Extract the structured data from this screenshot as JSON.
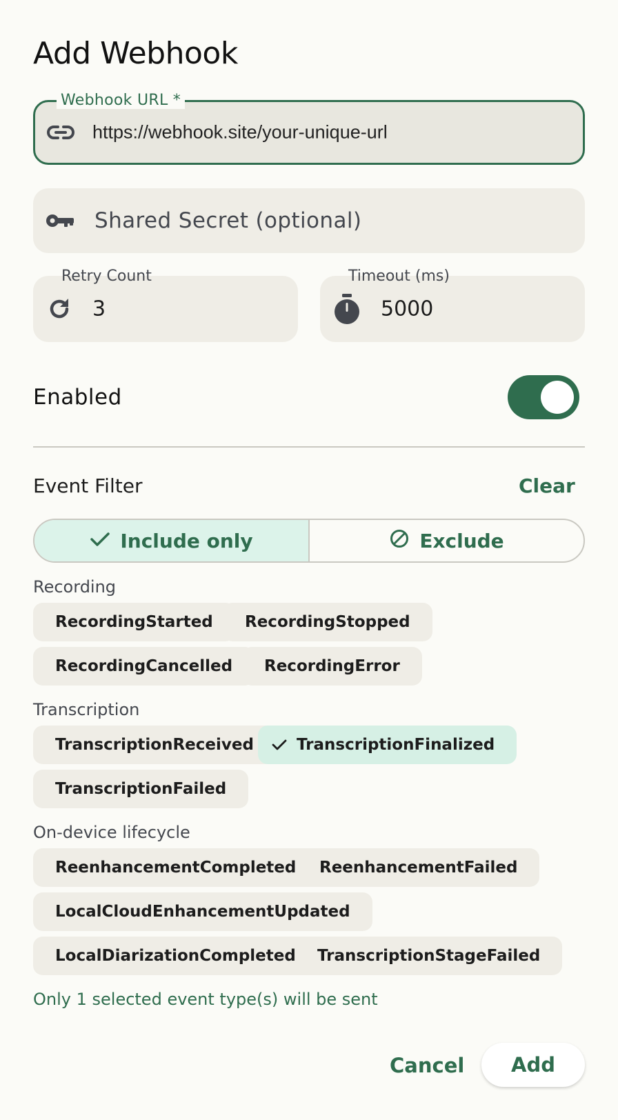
{
  "dialog": {
    "title": "Add Webhook"
  },
  "url_field": {
    "label": "Webhook URL *",
    "value": "https://webhook.site/your-unique-url",
    "icon": "link-icon"
  },
  "secret_field": {
    "placeholder": "Shared Secret (optional)",
    "icon": "key-icon"
  },
  "retry_field": {
    "label": "Retry Count",
    "value": "3",
    "icon": "refresh-icon"
  },
  "timeout_field": {
    "label": "Timeout (ms)",
    "value": "5000",
    "icon": "timer-icon"
  },
  "enabled": {
    "label": "Enabled",
    "on": true
  },
  "event_filter": {
    "label": "Event Filter",
    "clear_label": "Clear",
    "mode_options": [
      {
        "label": "Include only",
        "icon": "check-icon",
        "active": true
      },
      {
        "label": "Exclude",
        "icon": "block-icon",
        "active": false
      }
    ],
    "groups": [
      {
        "label": "Recording",
        "events": [
          {
            "name": "RecordingStarted",
            "selected": false
          },
          {
            "name": "RecordingStopped",
            "selected": false
          },
          {
            "name": "RecordingCancelled",
            "selected": false
          },
          {
            "name": "RecordingError",
            "selected": false
          }
        ]
      },
      {
        "label": "Transcription",
        "events": [
          {
            "name": "TranscriptionReceived",
            "selected": false
          },
          {
            "name": "TranscriptionFinalized",
            "selected": true
          },
          {
            "name": "TranscriptionFailed",
            "selected": false
          }
        ]
      },
      {
        "label": "On-device lifecycle",
        "events": [
          {
            "name": "ReenhancementCompleted",
            "selected": false
          },
          {
            "name": "ReenhancementFailed",
            "selected": false
          },
          {
            "name": "LocalCloudEnhancementUpdated",
            "selected": false
          },
          {
            "name": "LocalDiarizationCompleted",
            "selected": false
          },
          {
            "name": "TranscriptionStageFailed",
            "selected": false
          }
        ]
      }
    ],
    "summary": "Only 1 selected event type(s) will be sent"
  },
  "actions": {
    "cancel_label": "Cancel",
    "add_label": "Add"
  },
  "colors": {
    "accent": "#2f6d4e",
    "surface": "#fbfbf7",
    "field": "#efede6",
    "selected_chip": "#d6f0e5"
  }
}
